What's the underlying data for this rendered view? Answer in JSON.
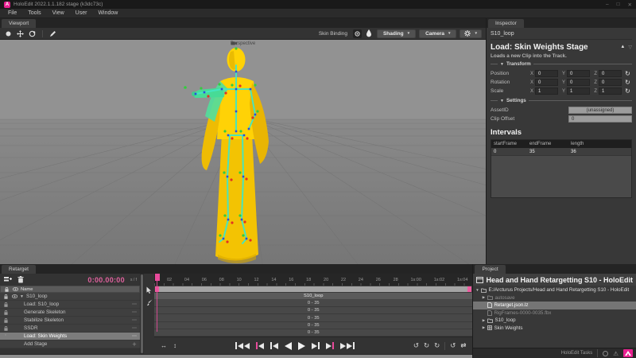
{
  "titlebar": {
    "title": "HoloEdit 2022.1.1.182 stage (k3dc73c)",
    "logo_letter": "A",
    "controls": {
      "minimize": "–",
      "maximize": "□",
      "close": "✕"
    }
  },
  "menubar": {
    "items": [
      "File",
      "Tools",
      "View",
      "User",
      "Window"
    ]
  },
  "viewport": {
    "tab": "Viewport",
    "perspective_label": "Perspective",
    "skin_binding_label": "Skin Binding",
    "shading_button": "Shading",
    "camera_button": "Camera"
  },
  "icons": {
    "dropdown": "▾",
    "collapse_up": "▲",
    "collapse_down": "▽",
    "section_arrow": "▼",
    "expand": "▶",
    "expanded": "▼",
    "dots_menu": "⋯",
    "plus": "＋",
    "asterisk": "*",
    "reset": "↻",
    "loop_a": "↺",
    "loop_b": "↻",
    "loop_c": "↻",
    "chat_loop": "↺",
    "swap": "⇄",
    "fit_range": "↔",
    "fit_height": "↕",
    "warning": "⚠"
  },
  "inspector": {
    "tab": "Inspector",
    "clip_name": "S10_loop",
    "stage_title": "Load: Skin Weights Stage",
    "stage_subtitle": "Loads a new Clip into the Track.",
    "transform_section": "Transform",
    "axis": {
      "x": "X",
      "y": "Y",
      "z": "Z"
    },
    "transform_rows": [
      {
        "label": "Position",
        "x": "0",
        "y": "0",
        "z": "0"
      },
      {
        "label": "Rotation",
        "x": "0",
        "y": "0",
        "z": "0"
      },
      {
        "label": "Scale",
        "x": "1",
        "y": "1",
        "z": "1"
      }
    ],
    "settings_section": "Settings",
    "asset_id_label": "AssetID",
    "asset_id_value": "(unassigned)",
    "clip_offset_label": "Clip Offset",
    "clip_offset_value": "0",
    "intervals_title": "Intervals",
    "intervals_headers": [
      "startFrame",
      "endFrame",
      "length"
    ],
    "intervals_row": [
      "0",
      "35",
      "36"
    ]
  },
  "retarget": {
    "tab": "Retarget",
    "timecode": "0:00.00:00",
    "timecode_units": "s / f",
    "name_header": "Name",
    "group_label": "S10_loop",
    "stages": [
      "Load: S10_loop",
      "Generate Skeleton",
      "Stabilize Skeleton",
      "SSDR",
      "Load: Skin Weights"
    ],
    "add_stage_label": "Add Stage"
  },
  "timeline": {
    "ticks": [
      "02",
      "04",
      "06",
      "08",
      "10",
      "12",
      "14",
      "16",
      "18",
      "20",
      "22",
      "24",
      "26",
      "28",
      "1s:00",
      "1s:02",
      "1s:04"
    ],
    "clip_label": "S10_loop",
    "range_labels": [
      "0 - 35",
      "0 - 35",
      "0 - 35",
      "0 - 35",
      "0 - 35"
    ]
  },
  "project": {
    "tab": "Project",
    "title": "Head and Hand Retargetting S10 - HoloEdit",
    "tree": [
      {
        "label": "E:/Arcturus Projects/Head and Hand Retargetting S10 - HoloEdit"
      },
      {
        "label": "autosave"
      },
      {
        "label": "Retarget.json.lz"
      },
      {
        "label": "RigFrames-0000-0035.fbx"
      },
      {
        "label": "S10_loop"
      },
      {
        "label": "Skin Weights"
      }
    ]
  },
  "statusbar": {
    "tasks_label": "HoloEdit Tasks"
  },
  "colors": {
    "accent_pink": "#e84a9b",
    "model_yellow": "#f6c800",
    "skeleton_cyan": "#43e6c4",
    "arm_green": "#47db96"
  }
}
